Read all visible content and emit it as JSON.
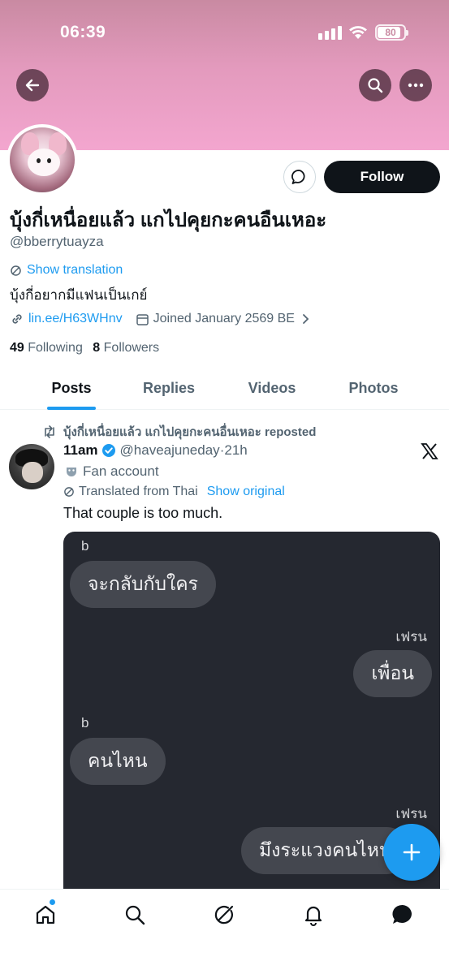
{
  "status_bar": {
    "time": "06:39",
    "battery": "80"
  },
  "profile": {
    "name": "บุ้งกี่เหนื่อยแล้ว แกไปคุยกะคนอืนเหอะ",
    "handle": "@bberrytuayza",
    "show_translation": "Show translation",
    "bio": "บุ้งกี่อยากมีแฟนเป็นเกย์",
    "link": "lin.ee/H63WHnv",
    "joined": "Joined January 2569 BE",
    "following_count": "49",
    "following_label": "Following",
    "followers_count": "8",
    "followers_label": "Followers",
    "follow_label": "Follow"
  },
  "tabs": [
    {
      "label": "Posts",
      "active": true
    },
    {
      "label": "Replies"
    },
    {
      "label": "Videos"
    },
    {
      "label": "Photos"
    }
  ],
  "post": {
    "repost_text": "บุ้งกี่เหนื่อยแล้ว แกไปคุยกะคนอื่นเหอะ reposted",
    "author": "11am",
    "handle": "@haveajuneday",
    "sep": "·",
    "time": "21h",
    "label": "Fan account",
    "translated": "Translated from Thai",
    "show_original": "Show original",
    "text": "That couple is too much.",
    "chat": [
      {
        "name": "b",
        "text": "จะกลับกับใคร"
      },
      {
        "name": "เฟรน",
        "text": "เพื่อน"
      },
      {
        "name": "b",
        "text": "คนไหน"
      },
      {
        "name": "เฟรน",
        "text": "มึงระแวงคนไหน"
      }
    ]
  },
  "colors": {
    "accent": "#1d9bf0",
    "banner": "#e39abd",
    "text": "#0f1419",
    "muted": "#536471"
  }
}
